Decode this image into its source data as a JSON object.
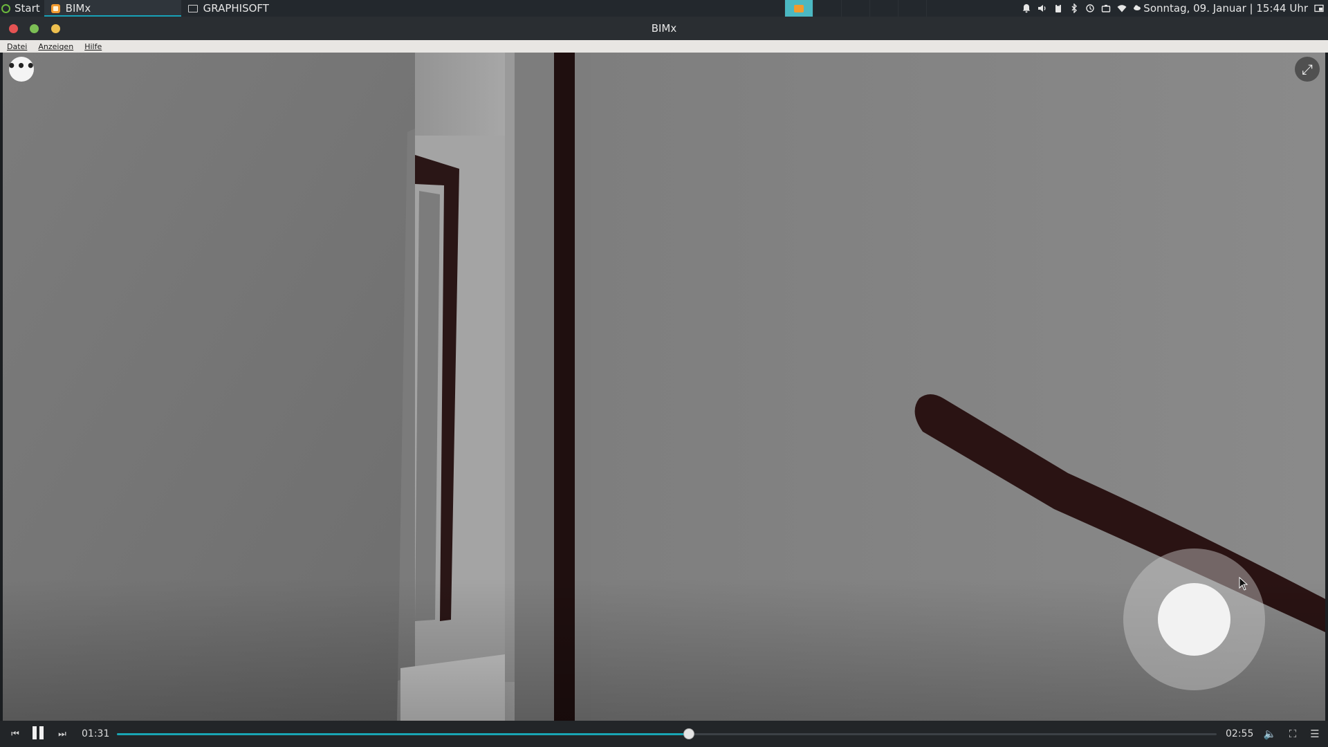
{
  "taskbar": {
    "start_label": "Start",
    "tasks": [
      {
        "label": "BIMx",
        "icon": "bimx-app-icon",
        "active": true
      },
      {
        "label": "GRAPHISOFT",
        "icon": "folder-icon",
        "active": false
      }
    ],
    "clock": "Sonntag, 09. Januar | 15:44 Uhr",
    "tray_icons": [
      "bell-icon",
      "volume-icon",
      "clipboard-icon",
      "bluetooth-icon",
      "update-icon",
      "battery-icon",
      "wifi-icon",
      "weather-icon"
    ]
  },
  "window": {
    "title": "BIMx"
  },
  "menubar": {
    "items": [
      "Datei",
      "Anzeigen",
      "Hilfe"
    ]
  },
  "video": {
    "more_button_glyph": "•••",
    "expand_button_glyph": "⤢"
  },
  "player": {
    "current_time": "01:31",
    "total_time": "02:55",
    "progress": 0.52,
    "prev_glyph": "⏮",
    "next_glyph": "⏭",
    "volume_glyph": "🔈",
    "fullscreen_glyph": "⛶",
    "playlist_glyph": "☰"
  },
  "colors": {
    "accent": "#19a6b5",
    "taskbar_bg": "#23282d",
    "menubar_bg": "#e8e6e3"
  }
}
